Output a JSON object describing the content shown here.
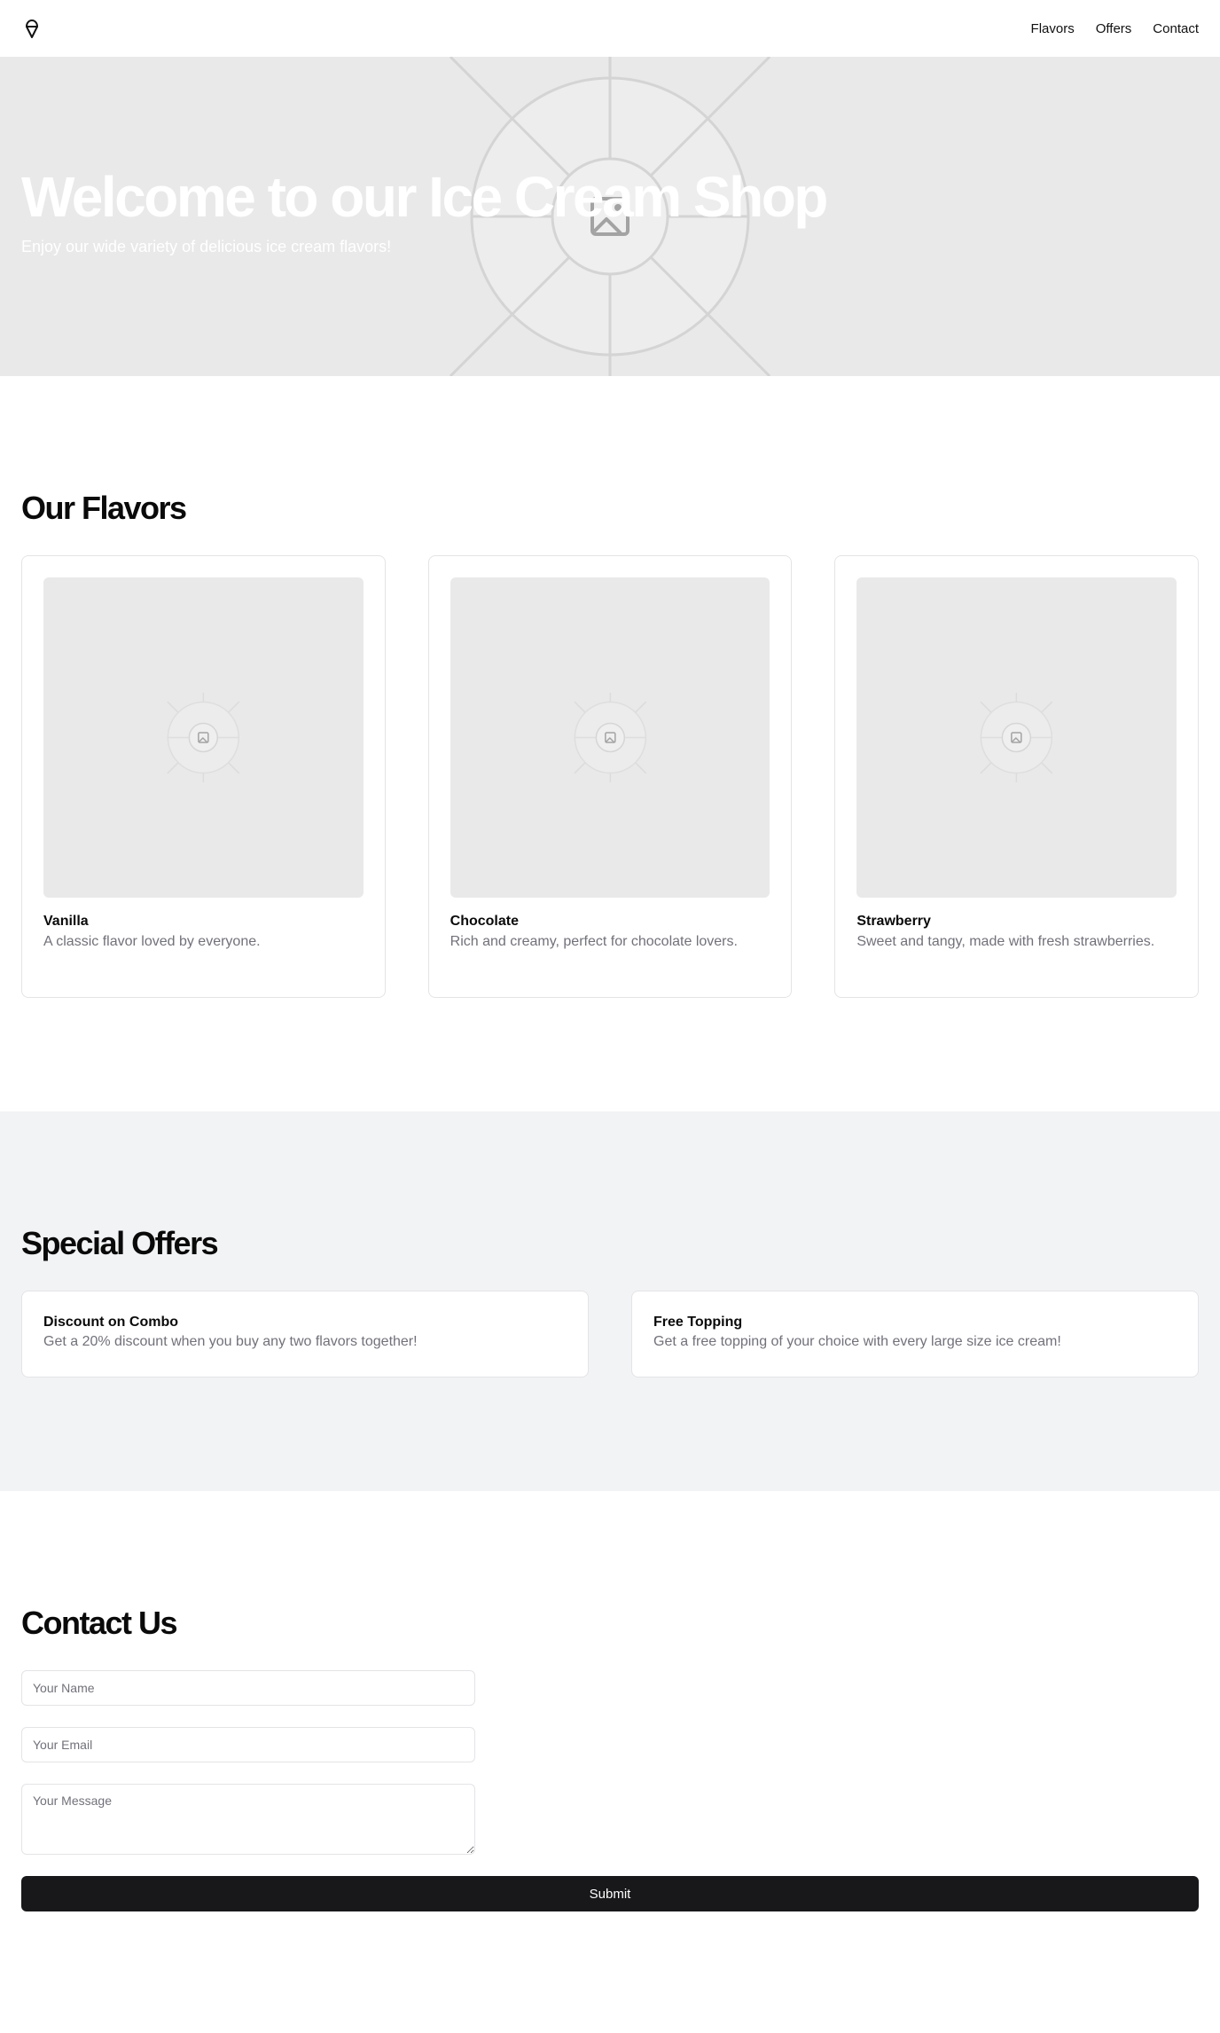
{
  "header": {
    "logo_icon": "ice-cream-icon",
    "nav": [
      {
        "label": "Flavors"
      },
      {
        "label": "Offers"
      },
      {
        "label": "Contact"
      }
    ]
  },
  "hero": {
    "title": "Welcome to our Ice Cream Shop",
    "subtitle": "Enjoy our wide variety of delicious ice cream flavors!",
    "image_icon": "image-placeholder-icon"
  },
  "flavors": {
    "title": "Our Flavors",
    "items": [
      {
        "name": "Vanilla",
        "description": "A classic flavor loved by everyone."
      },
      {
        "name": "Chocolate",
        "description": "Rich and creamy, perfect for chocolate lovers."
      },
      {
        "name": "Strawberry",
        "description": "Sweet and tangy, made with fresh strawberries."
      }
    ]
  },
  "offers": {
    "title": "Special Offers",
    "items": [
      {
        "name": "Discount on Combo",
        "description": "Get a 20% discount when you buy any two flavors together!"
      },
      {
        "name": "Free Topping",
        "description": "Get a free topping of your choice with every large size ice cream!"
      }
    ]
  },
  "contact": {
    "title": "Contact Us",
    "name_placeholder": "Your Name",
    "email_placeholder": "Your Email",
    "message_placeholder": "Your Message",
    "submit_label": "Submit"
  },
  "colors": {
    "background": "#ffffff",
    "offers_background": "#f2f3f5",
    "placeholder_gray": "#e9e9e9",
    "button_bg": "#18181b",
    "muted_text": "#71717a"
  }
}
